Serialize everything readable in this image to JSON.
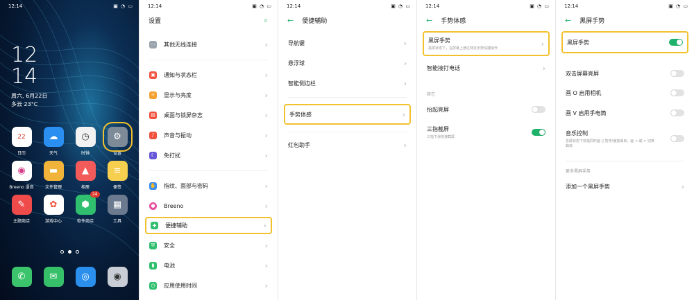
{
  "status": {
    "time": "12:14"
  },
  "home": {
    "clock_hour": "12",
    "clock_minute": "14",
    "date": "周六, 6月22日",
    "weather": "多云 23°C",
    "apps": [
      {
        "label": "日历",
        "icon": "calendar-icon",
        "glyph": "22",
        "color": "#ffffff"
      },
      {
        "label": "天气",
        "icon": "weather-cloud-icon",
        "glyph": "☁",
        "color": "#2a8ff0"
      },
      {
        "label": "时钟",
        "icon": "clock-icon",
        "glyph": "◷",
        "color": "#f2f2f2"
      },
      {
        "label": "设置",
        "icon": "settings-gear-icon",
        "glyph": "⚙",
        "color": "#7d8a97"
      },
      {
        "label": "Breeno 语音",
        "icon": "breeno-voice-icon",
        "glyph": "◉",
        "color": "#ffffff"
      },
      {
        "label": "文件管理",
        "icon": "folder-icon",
        "glyph": "▬",
        "color": "#f2b33a"
      },
      {
        "label": "相册",
        "icon": "photos-icon",
        "glyph": "▲",
        "color": "#f35a5a"
      },
      {
        "label": "便签",
        "icon": "notes-icon",
        "glyph": "≡",
        "color": "#f6cf4f"
      },
      {
        "label": "主题商店",
        "icon": "theme-store-icon",
        "glyph": "✎",
        "color": "#ef4b4b"
      },
      {
        "label": "游戏中心",
        "icon": "game-center-icon",
        "glyph": "✿",
        "color": "#ffffff"
      },
      {
        "label": "软件商店",
        "icon": "app-store-icon",
        "glyph": "⬢",
        "color": "#2fbf6e",
        "badge": "24"
      },
      {
        "label": "工具",
        "icon": "tools-folder-icon",
        "glyph": "▦",
        "color": "#6b7a8e"
      }
    ],
    "dock": [
      {
        "icon": "phone-icon",
        "glyph": "✆",
        "color": "#3cc46d"
      },
      {
        "icon": "messages-icon",
        "glyph": "✉",
        "color": "#37c06a"
      },
      {
        "icon": "browser-icon",
        "glyph": "◎",
        "color": "#2b8fed"
      },
      {
        "icon": "camera-icon",
        "glyph": "◉",
        "color": "#c9ced6"
      }
    ]
  },
  "settings": {
    "title": "设置",
    "items": [
      {
        "label": "其他无线连接",
        "icon": "more-connections-icon",
        "color": "#9aa4ad"
      },
      {
        "label": "通知与状态栏",
        "icon": "notification-icon",
        "color": "#f0503c"
      },
      {
        "label": "显示与亮度",
        "icon": "brightness-icon",
        "color": "#f4a12f"
      },
      {
        "label": "桌面与锁屏杂志",
        "icon": "wallpaper-icon",
        "color": "#f0503c"
      },
      {
        "label": "声音与振动",
        "icon": "sound-icon",
        "color": "#f0503c"
      },
      {
        "label": "免打扰",
        "icon": "do-not-disturb-icon",
        "color": "#6557d8"
      },
      {
        "label": "指纹、面部与密码",
        "icon": "fingerprint-icon",
        "color": "#3b8ff0"
      },
      {
        "label": "Breeno",
        "icon": "breeno-icon",
        "color": "#e64a9c"
      },
      {
        "label": "便捷辅助",
        "icon": "assist-icon",
        "color": "#2fbf6e"
      },
      {
        "label": "安全",
        "icon": "security-shield-icon",
        "color": "#2fbf6e"
      },
      {
        "label": "电池",
        "icon": "battery-icon",
        "color": "#2fbf6e"
      },
      {
        "label": "应用使用时间",
        "icon": "usage-time-icon",
        "color": "#2fbf6e"
      }
    ]
  },
  "assist": {
    "title": "便捷辅助",
    "items": [
      "导航键",
      "悬浮球",
      "智能侧边栏",
      "手势体感",
      "红包助手"
    ]
  },
  "gestures": {
    "title": "手势体感",
    "items": [
      {
        "label": "黑屏手势",
        "sub": "黑屏状态下，在屏幕上通过特定手势快捷操作"
      },
      {
        "label": "智能接打电话"
      }
    ],
    "section": "其它",
    "toggles": [
      {
        "label": "抬起亮屏",
        "on": false
      },
      {
        "label": "三指截屏",
        "sub": "三指下滑快速截屏",
        "on": true
      }
    ]
  },
  "screen_off": {
    "title": "黑屏手势",
    "main": {
      "label": "黑屏手势",
      "on": true
    },
    "toggles": [
      {
        "label": "双击屏幕亮屏",
        "on": false
      },
      {
        "label": "画 O 启用相机",
        "on": false
      },
      {
        "label": "画 V 启用手电筒",
        "on": false
      },
      {
        "label": "音乐控制",
        "sub": "息屏状态下双指同时画 || 暂停/播放曲目，画 < 或 > 切换曲目",
        "on": false
      }
    ],
    "section": "更多黑屏手势",
    "add": "添加一个黑屏手势"
  },
  "colors": {
    "accent": "#1fb26b",
    "highlight": "#f2c12e"
  }
}
